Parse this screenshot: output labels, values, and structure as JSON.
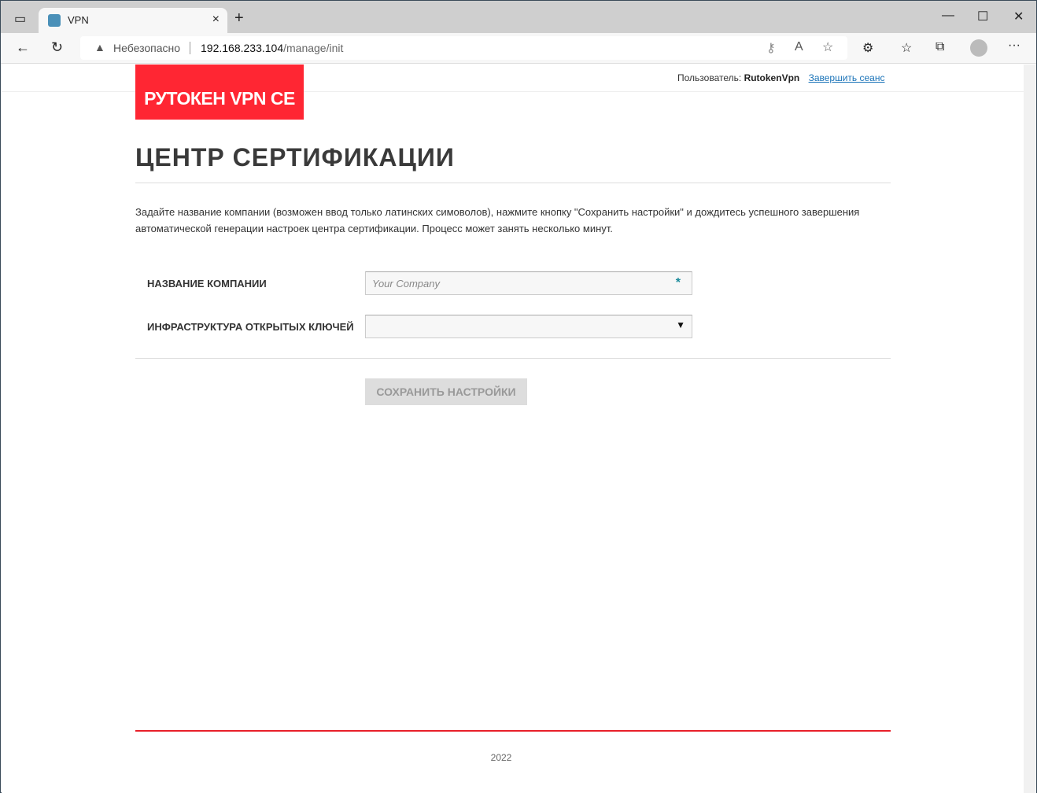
{
  "browser": {
    "tab_title": "VPN",
    "insecure_label": "Небезопасно",
    "url_host": "192.168.233.104",
    "url_path": "/manage/init"
  },
  "header": {
    "logo": "РУТОКЕН VPN CE",
    "user_label": "Пользователь:",
    "user_name": "RutokenVpn",
    "logout": "Завершить сеанс"
  },
  "main": {
    "title": "ЦЕНТР СЕРТИФИКАЦИИ",
    "description": "Задайте название компании (возможен ввод только латинских симоволов), нажмите кнопку \"Сохранить настройки\" и дождитесь успешного завершения автоматической генерации настроек центра сертификации. Процесс может занять несколько минут.",
    "company_label": "НАЗВАНИЕ КОМПАНИИ",
    "company_placeholder": "Your Company",
    "required_mark": "*",
    "pki_label": "ИНФРАСТРУКТУРА ОТКРЫТЫХ КЛЮЧЕЙ",
    "save_button": "СОХРАНИТЬ НАСТРОЙКИ"
  },
  "footer": {
    "year": "2022"
  }
}
